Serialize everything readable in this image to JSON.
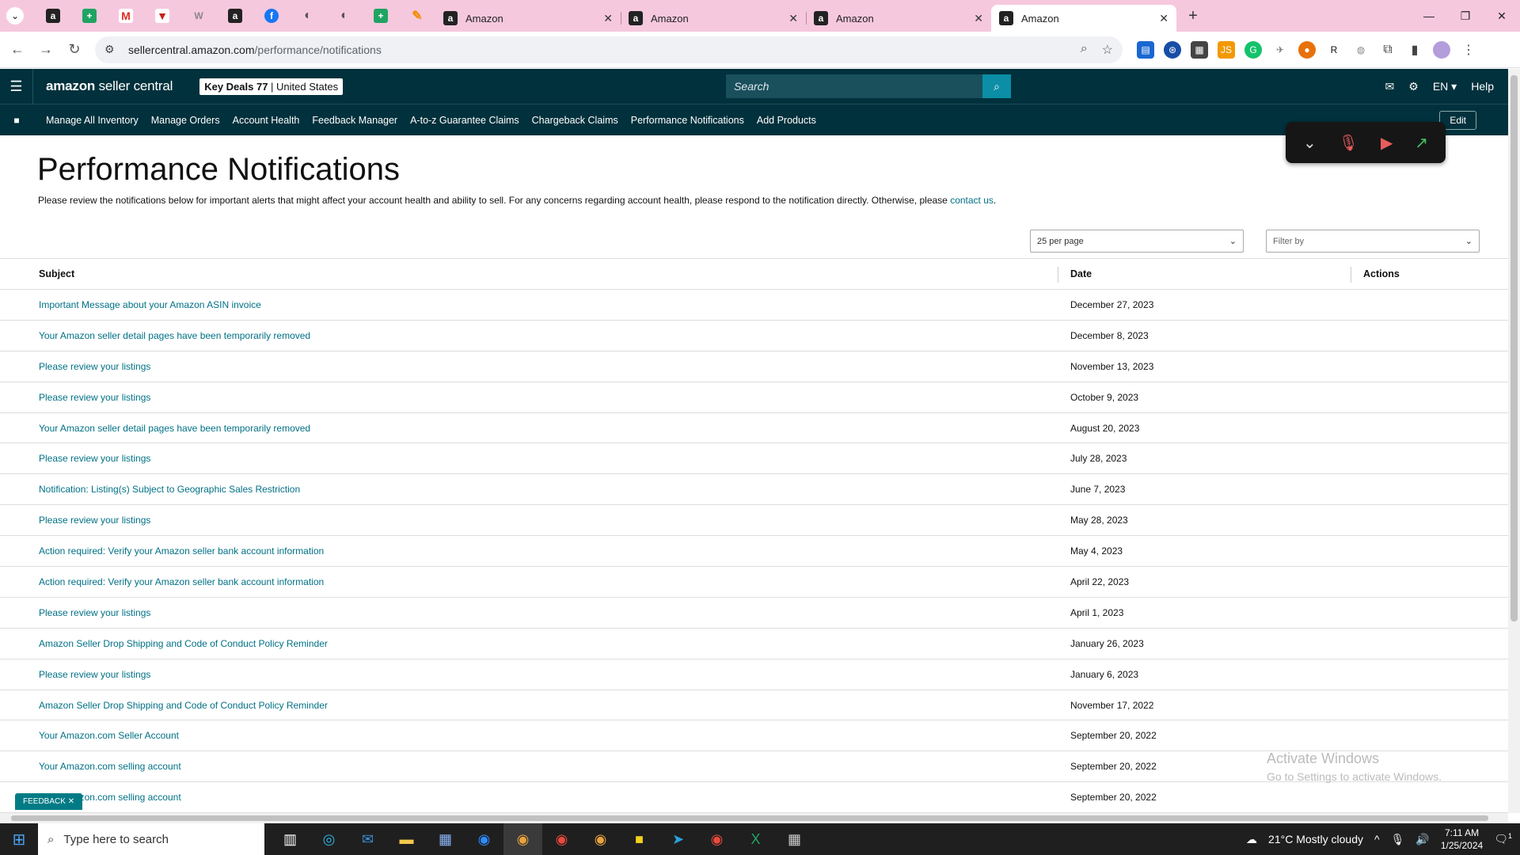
{
  "browser": {
    "pinned_tabs": [
      {
        "icon": "amazon-icon",
        "glyph": "a"
      },
      {
        "icon": "sheets-icon",
        "glyph": "+"
      },
      {
        "icon": "gmail-icon",
        "glyph": "M"
      },
      {
        "icon": "shield-icon",
        "glyph": "▼"
      },
      {
        "icon": "wp-icon",
        "glyph": "W"
      },
      {
        "icon": "amazon-icon",
        "glyph": "a"
      },
      {
        "icon": "facebook-icon",
        "glyph": "f"
      },
      {
        "icon": "globe-icon",
        "glyph": "◐"
      },
      {
        "icon": "globe-icon",
        "glyph": "◐"
      },
      {
        "icon": "sheets-icon",
        "glyph": "+"
      },
      {
        "icon": "pen-icon",
        "glyph": "✎"
      }
    ],
    "tabs": [
      {
        "title": "Amazon",
        "active": false
      },
      {
        "title": "Amazon",
        "active": false
      },
      {
        "title": "Amazon",
        "active": false
      },
      {
        "title": "Amazon",
        "active": true
      }
    ],
    "url_host": "sellercentral.amazon.com",
    "url_path": "/performance/notifications"
  },
  "header": {
    "logo_bold": "amazon",
    "logo_rest": " seller central",
    "store_name": "Key Deals 77",
    "region": "United States",
    "search_placeholder": "Search",
    "lang": "EN",
    "help": "Help"
  },
  "nav": {
    "links": [
      "Manage All Inventory",
      "Manage Orders",
      "Account Health",
      "Feedback Manager",
      "A-to-z Guarantee Claims",
      "Chargeback Claims",
      "Performance Notifications",
      "Add Products"
    ],
    "edit": "Edit"
  },
  "page": {
    "title": "Performance Notifications",
    "intro": "Please review the notifications below for important alerts that might affect your account health and ability to sell. For any concerns regarding account health, please respond to the notification directly. Otherwise, please ",
    "contact_link": "contact us",
    "intro_end": ".",
    "per_page": "25 per page",
    "filter_placeholder": "Filter by"
  },
  "table": {
    "headers": {
      "subject": "Subject",
      "date": "Date",
      "actions": "Actions"
    },
    "rows": [
      {
        "subject": "Important Message about your Amazon ASIN invoice",
        "date": "December 27, 2023"
      },
      {
        "subject": "Your Amazon seller detail pages have been temporarily removed",
        "date": "December 8, 2023"
      },
      {
        "subject": "Please review your listings",
        "date": "November 13, 2023"
      },
      {
        "subject": "Please review your listings",
        "date": "October 9, 2023"
      },
      {
        "subject": "Your Amazon seller detail pages have been temporarily removed",
        "date": "August 20, 2023"
      },
      {
        "subject": "Please review your listings",
        "date": "July 28, 2023"
      },
      {
        "subject": "Notification: Listing(s) Subject to Geographic Sales Restriction",
        "date": "June 7, 2023"
      },
      {
        "subject": "Please review your listings",
        "date": "May 28, 2023"
      },
      {
        "subject": "Action required: Verify your Amazon seller bank account information",
        "date": "May 4, 2023"
      },
      {
        "subject": "Action required: Verify your Amazon seller bank account information",
        "date": "April 22, 2023"
      },
      {
        "subject": "Please review your listings",
        "date": "April 1, 2023"
      },
      {
        "subject": "Amazon Seller Drop Shipping and Code of Conduct Policy Reminder",
        "date": "January 26, 2023"
      },
      {
        "subject": "Please review your listings",
        "date": "January 6, 2023"
      },
      {
        "subject": "Amazon Seller Drop Shipping and Code of Conduct Policy Reminder",
        "date": "November 17, 2022"
      },
      {
        "subject": "Your Amazon.com Seller Account",
        "date": "September 20, 2022"
      },
      {
        "subject": "Your Amazon.com selling account",
        "date": "September 20, 2022"
      },
      {
        "subject": "Your Amazon.com selling account",
        "date": "September 20, 2022"
      }
    ]
  },
  "feedback": "FEEDBACK",
  "watermark": {
    "line1": "Activate Windows",
    "line2": "Go to Settings to activate Windows."
  },
  "taskbar": {
    "search_placeholder": "Type here to search",
    "weather": "21°C  Mostly cloudy",
    "time": "7:11 AM",
    "date": "1/25/2024",
    "notification_count": "1"
  },
  "colors": {
    "header_bg": "#00313c",
    "link": "#007185",
    "tab_strip": "#f6c8de",
    "search_btn": "#0b8ea6"
  }
}
